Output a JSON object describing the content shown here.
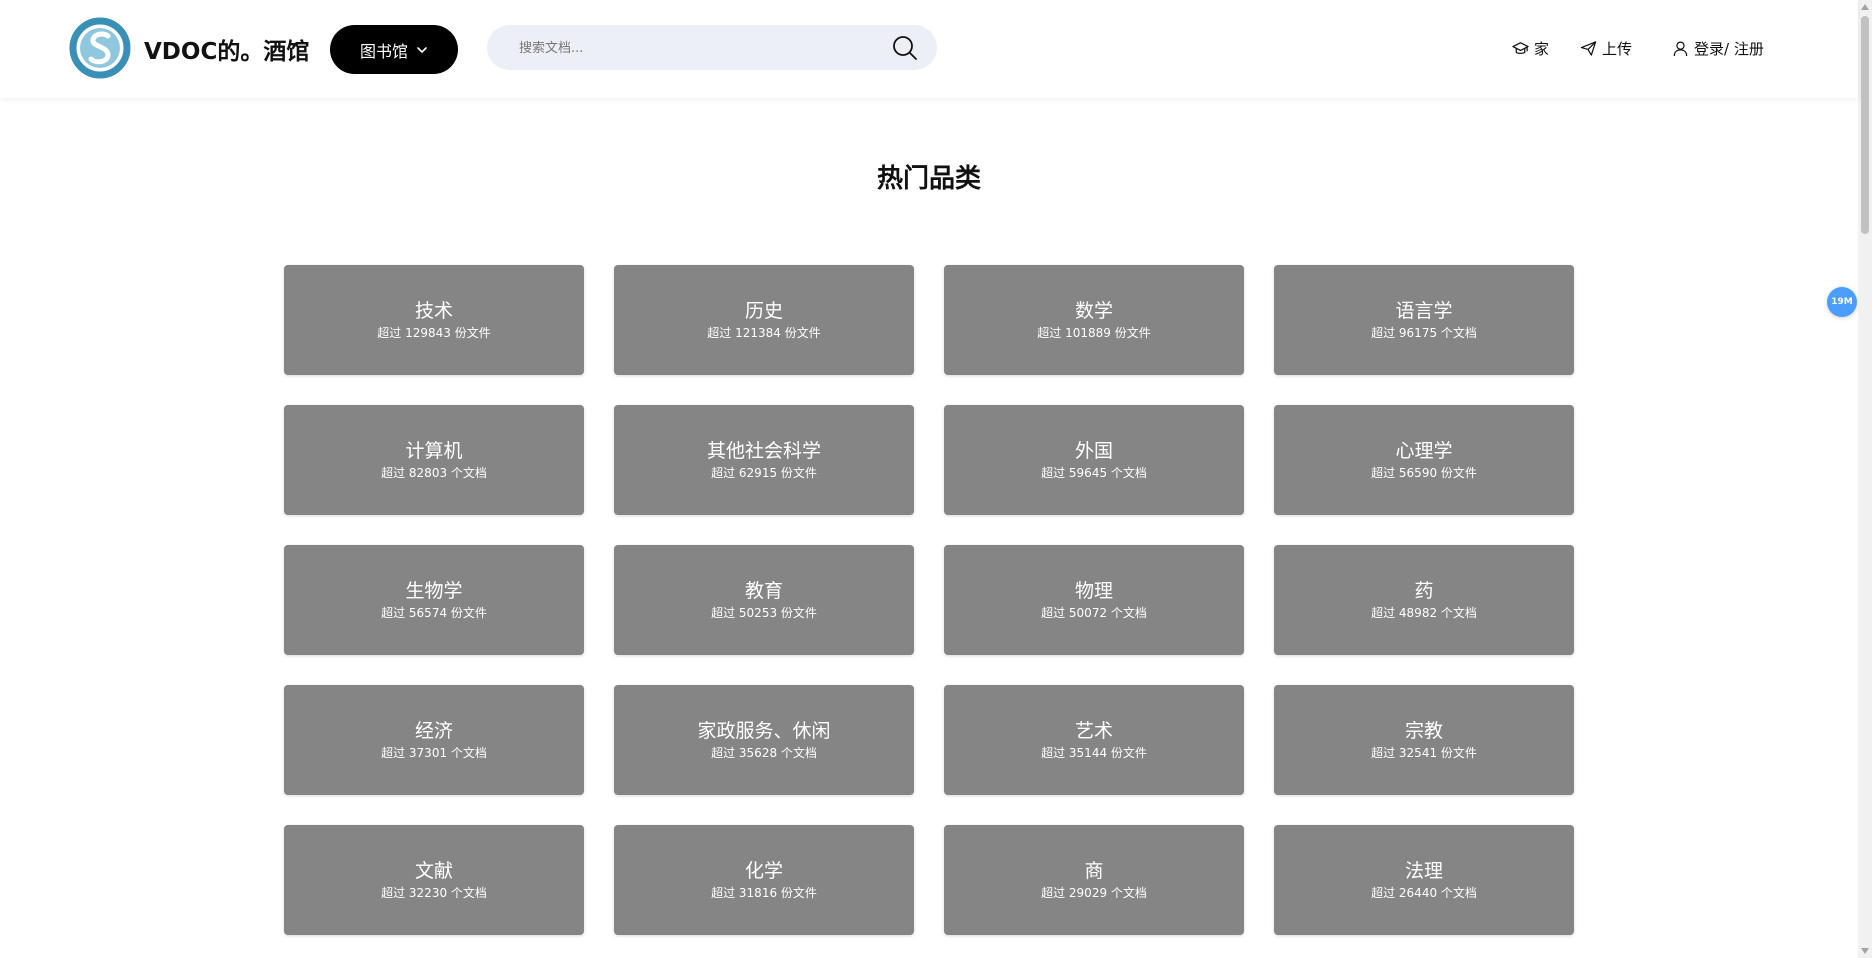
{
  "header": {
    "brand": "VDOC的。酒馆",
    "library_label": "图书馆",
    "search_placeholder": "搜索文档...",
    "nav_home": "家",
    "nav_upload": "上传",
    "nav_login": "登录/ 注册"
  },
  "section_title": "热门品类",
  "badge": "19M",
  "colors": {
    "card_bg": "#858585",
    "logo_primary": "#3a8fb7",
    "logo_secondary": "#8fc8de",
    "badge": "#4a9eff"
  },
  "categories": [
    {
      "name": "技术",
      "count": "超过 129843 份文件"
    },
    {
      "name": "历史",
      "count": "超过 121384 份文件"
    },
    {
      "name": "数学",
      "count": "超过 101889 份文件"
    },
    {
      "name": "语言学",
      "count": "超过 96175 个文档"
    },
    {
      "name": "计算机",
      "count": "超过 82803 个文档"
    },
    {
      "name": "其他社会科学",
      "count": "超过 62915 份文件"
    },
    {
      "name": "外国",
      "count": "超过 59645 个文档"
    },
    {
      "name": "心理学",
      "count": "超过 56590 份文件"
    },
    {
      "name": "生物学",
      "count": "超过 56574 份文件"
    },
    {
      "name": "教育",
      "count": "超过 50253 份文件"
    },
    {
      "name": "物理",
      "count": "超过 50072 个文档"
    },
    {
      "name": "药",
      "count": "超过 48982 个文档"
    },
    {
      "name": "经济",
      "count": "超过 37301 个文档"
    },
    {
      "name": "家政服务、休闲",
      "count": "超过 35628 个文档"
    },
    {
      "name": "艺术",
      "count": "超过 35144 份文件"
    },
    {
      "name": "宗教",
      "count": "超过 32541 份文件"
    },
    {
      "name": "文献",
      "count": "超过 32230 个文档"
    },
    {
      "name": "化学",
      "count": "超过 31816 份文件"
    },
    {
      "name": "商",
      "count": "超过 29029 个文档"
    },
    {
      "name": "法理",
      "count": "超过 26440 个文档"
    }
  ]
}
